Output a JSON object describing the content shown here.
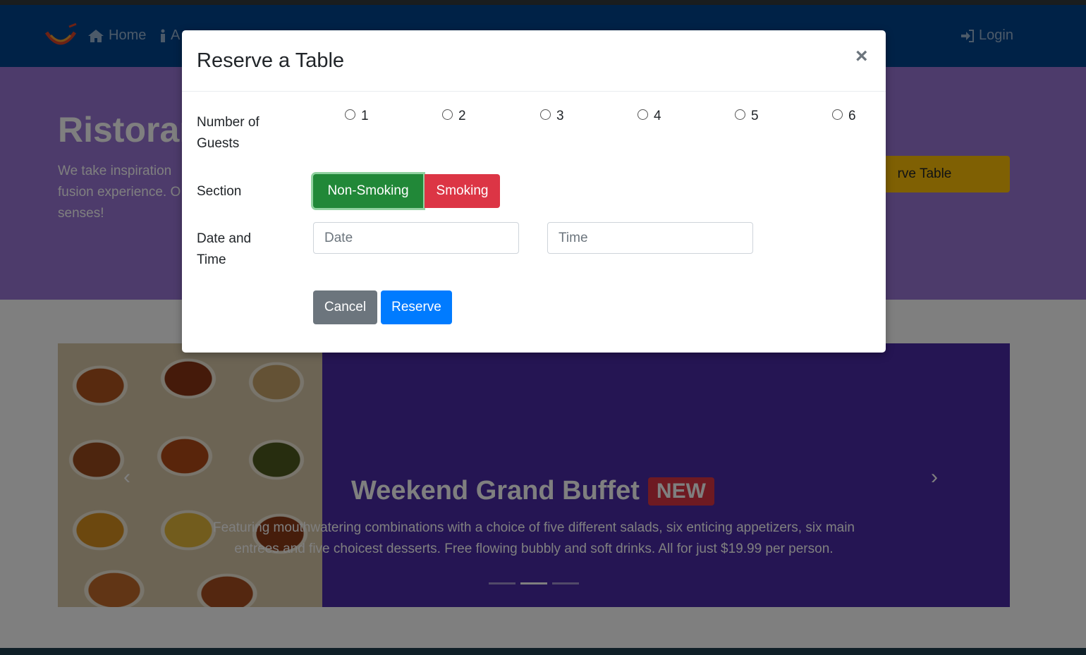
{
  "navbar": {
    "items": [
      {
        "label": "Home",
        "icon": "home-icon"
      },
      {
        "label": "A",
        "icon": "info-icon"
      }
    ],
    "login_label": "Login",
    "login_icon": "sign-in-icon",
    "bg_color": "#00448f"
  },
  "jumbotron": {
    "title": "Ristoran",
    "text": "We take inspiration fusion experience. O senses!",
    "button_label": "rve Table"
  },
  "carousel": {
    "title": "Weekend Grand Buffet",
    "badge": "NEW",
    "text": "Featuring mouthwatering combinations with a choice of five different salads, six enticing appetizers, six main entrees and five choicest desserts. Free flowing bubbly and soft drinks. All for just $19.99 per person.",
    "active_slide": 2,
    "slide_count": 3
  },
  "modal": {
    "title": "Reserve a Table",
    "close_symbol": "×",
    "guests_label": "Number of Guests",
    "guest_options": [
      "1",
      "2",
      "3",
      "4",
      "5",
      "6"
    ],
    "section_label": "Section",
    "section_options": [
      "Non-Smoking",
      "Smoking"
    ],
    "section_selected": "Non-Smoking",
    "datetime_label": "Date and Time",
    "date_placeholder": "Date",
    "time_placeholder": "Time",
    "cancel_label": "Cancel",
    "reserve_label": "Reserve"
  },
  "colors": {
    "primary": "#007bff",
    "success": "#218838",
    "danger": "#dc3545",
    "secondary": "#6c757d",
    "warning": "#ffc107"
  }
}
